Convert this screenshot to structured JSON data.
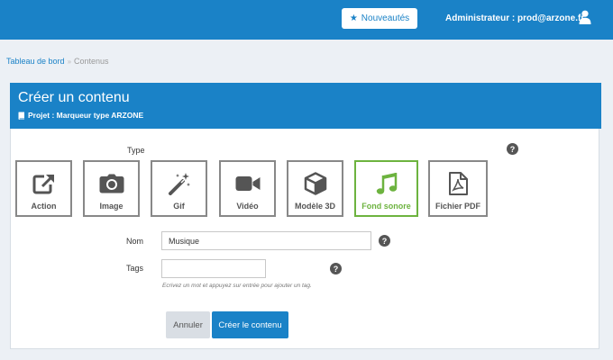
{
  "header": {
    "news_label": "Nouveautés",
    "admin_label": "Administrateur : prod@arzone.fr"
  },
  "breadcrumb": {
    "home": "Tableau de bord",
    "current": "Contenus"
  },
  "card": {
    "title": "Créer un contenu",
    "subtitle": "Projet : Marqueur type ARZONE"
  },
  "form": {
    "type_label": "Type",
    "types": [
      {
        "label": "Action",
        "icon": "external-link-icon"
      },
      {
        "label": "Image",
        "icon": "camera-icon"
      },
      {
        "label": "Gif",
        "icon": "magic-wand-icon"
      },
      {
        "label": "Vidéo",
        "icon": "video-camera-icon"
      },
      {
        "label": "Modèle 3D",
        "icon": "cube-icon"
      },
      {
        "label": "Fond sonore",
        "icon": "music-note-icon",
        "selected": true
      },
      {
        "label": "Fichier PDF",
        "icon": "pdf-file-icon"
      }
    ],
    "name_label": "Nom",
    "name_value": "Musique",
    "tags_label": "Tags",
    "tags_value": "",
    "tags_hint": "Ecrivez un mot et appuyez sur entrée pour ajouter un tag.",
    "help_glyph": "?",
    "cancel_label": "Annuler",
    "submit_label": "Créer le contenu"
  },
  "colors": {
    "brand": "#1a82c7",
    "selected": "#6db33f",
    "tile_border": "#888888",
    "icon": "#555555"
  }
}
